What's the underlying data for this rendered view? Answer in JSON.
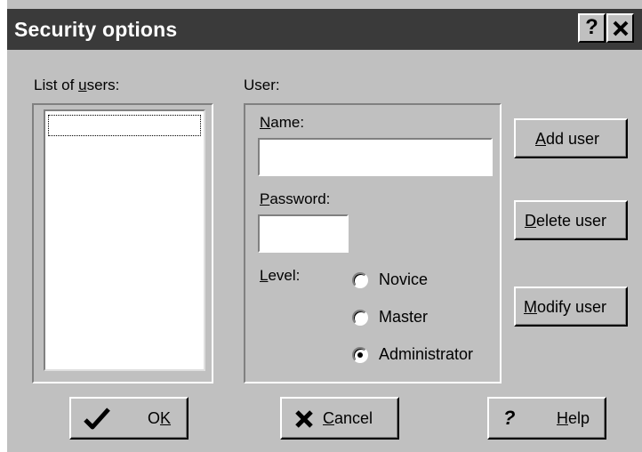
{
  "window": {
    "title": "Security options",
    "help_button": "?",
    "close_button": "✕"
  },
  "users_list": {
    "label_pre": "List of ",
    "label_key": "u",
    "label_post": "sers:",
    "items": []
  },
  "user_group": {
    "label": "User:",
    "name_label_key": "N",
    "name_label_rest": "ame:",
    "name_value": "",
    "password_label_key": "P",
    "password_label_rest": "assword:",
    "password_value": "",
    "level_label_key": "L",
    "level_label_rest": "evel:",
    "levels": [
      "Novice",
      "Master",
      "Administrator"
    ],
    "selected_level": "Administrator"
  },
  "side_buttons": {
    "add_key": "A",
    "add_rest": "dd user",
    "delete_key": "D",
    "delete_rest": "elete user",
    "modify_key": "M",
    "modify_rest": "odify user"
  },
  "bottom_buttons": {
    "ok_pre": "O",
    "ok_key": "K",
    "cancel_key": "C",
    "cancel_rest": "ancel",
    "help_key": "H",
    "help_rest": "elp",
    "ok_icon": "checkmark-icon",
    "cancel_icon": "x-icon",
    "help_icon": "question-icon"
  },
  "colors": {
    "face": "#c0c0c0",
    "titlebar": "#3a3a3a",
    "title_text": "#ffffff"
  }
}
